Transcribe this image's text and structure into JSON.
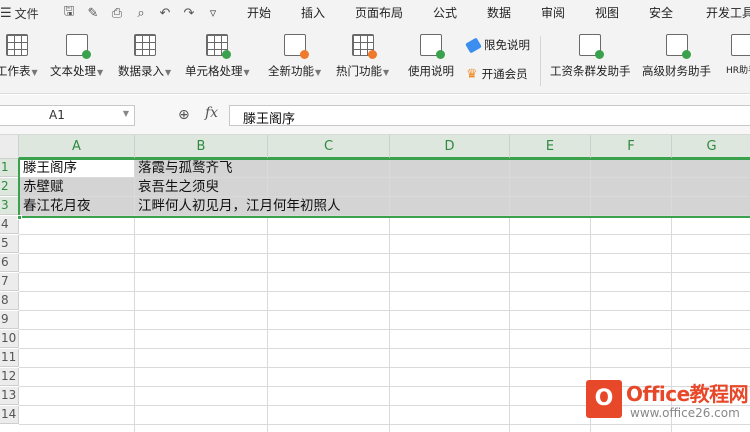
{
  "menubar": {
    "file_label": "文件",
    "tabs": [
      "开始",
      "插入",
      "页面布局",
      "公式",
      "数据",
      "审阅",
      "视图",
      "安全",
      "开发工具"
    ]
  },
  "ribbon": {
    "buttons": [
      {
        "label": "工作表",
        "icon": "worksheet-icon"
      },
      {
        "label": "文本处理",
        "icon": "text-process-icon"
      },
      {
        "label": "数据录入",
        "icon": "data-entry-icon"
      },
      {
        "label": "单元格处理",
        "icon": "cell-process-icon"
      },
      {
        "label": "全新功能",
        "icon": "new-feature-icon"
      },
      {
        "label": "热门功能",
        "icon": "hot-feature-icon"
      },
      {
        "label": "使用说明",
        "icon": "usage-guide-icon"
      },
      {
        "label": "工资条群发助手",
        "icon": "payslip-icon"
      },
      {
        "label": "高级财务助手",
        "icon": "finance-icon"
      },
      {
        "label": "HR助手",
        "icon": "hr-icon"
      }
    ],
    "small": {
      "limit_free": "限免说明",
      "vip": "开通会员"
    }
  },
  "formula": {
    "namebox": "A1",
    "fx": "fx",
    "value": "滕王阁序"
  },
  "grid": {
    "columns": [
      "A",
      "B",
      "C",
      "D",
      "E",
      "F",
      "G"
    ],
    "rows": [
      "1",
      "2",
      "3",
      "4",
      "5",
      "6",
      "7",
      "8",
      "9",
      "10",
      "11",
      "12",
      "13",
      "14"
    ],
    "cells": [
      [
        "滕王阁序",
        "落霞与孤鹜齐飞"
      ],
      [
        "赤壁赋",
        "哀吾生之须臾"
      ],
      [
        "春江花月夜",
        "江畔何人初见月，江月何年初照人"
      ]
    ]
  },
  "watermark": {
    "brand": "Office教程网",
    "url": "www.office26.com",
    "logo": "O"
  }
}
